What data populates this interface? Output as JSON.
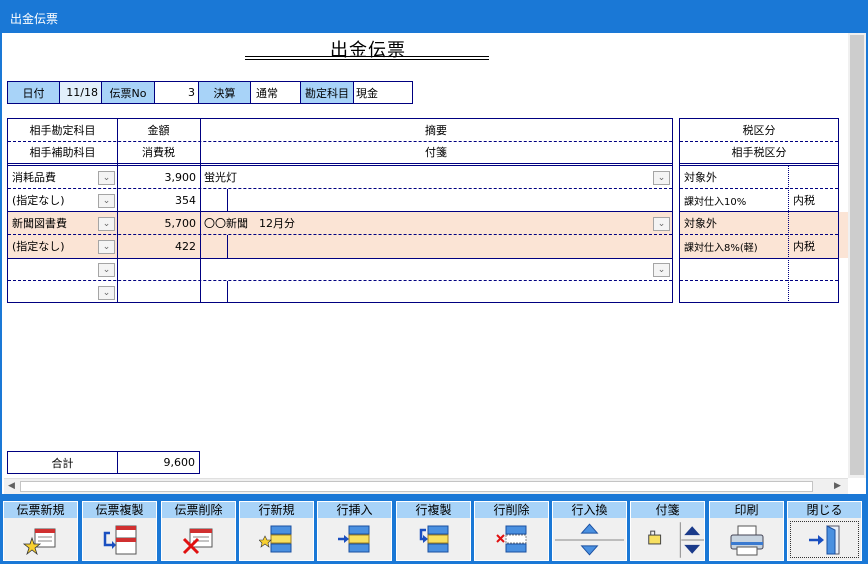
{
  "window": {
    "title": "出金伝票"
  },
  "document": {
    "title": "出金伝票"
  },
  "header": {
    "date_label": "日付",
    "date_value": "11/18",
    "no_label": "伝票No",
    "no_value": "3",
    "settle_label": "決算",
    "settle_value": "通常",
    "account_label": "勘定科目",
    "account_value": "現金"
  },
  "columns": {
    "counter_account": "相手勘定科目",
    "counter_sub": "相手補助科目",
    "amount": "金額",
    "tax": "消費税",
    "summary": "摘要",
    "tag": "付箋",
    "tax_cat": "税区分",
    "counter_tax_cat": "相手税区分"
  },
  "rows": [
    {
      "account": "消耗品費",
      "sub": "(指定なし)",
      "amount": "3,900",
      "tax": "354",
      "summary": "蛍光灯",
      "tax_cat": "対象外",
      "counter_tax": "課対仕入10%",
      "inclusive": "内税"
    },
    {
      "account": "新聞図書費",
      "sub": "(指定なし)",
      "amount": "5,700",
      "tax": "422",
      "summary": "〇〇新聞　12月分",
      "tax_cat": "対象外",
      "counter_tax": "課対仕入8%(軽)",
      "inclusive": "内税"
    }
  ],
  "total": {
    "label": "合計",
    "value": "9,600"
  },
  "toolbar": {
    "new_voucher": "伝票新規",
    "copy_voucher": "伝票複製",
    "delete_voucher": "伝票削除",
    "new_row": "行新規",
    "insert_row": "行挿入",
    "copy_row": "行複製",
    "delete_row": "行削除",
    "swap_row": "行入換",
    "tag": "付箋",
    "print": "印刷",
    "close": "閉じる"
  },
  "colors": {
    "frame": "#1a78d6",
    "label_bg": "#a8d3f8",
    "row_highlight": "#fbe4d5",
    "border": "#000080"
  }
}
